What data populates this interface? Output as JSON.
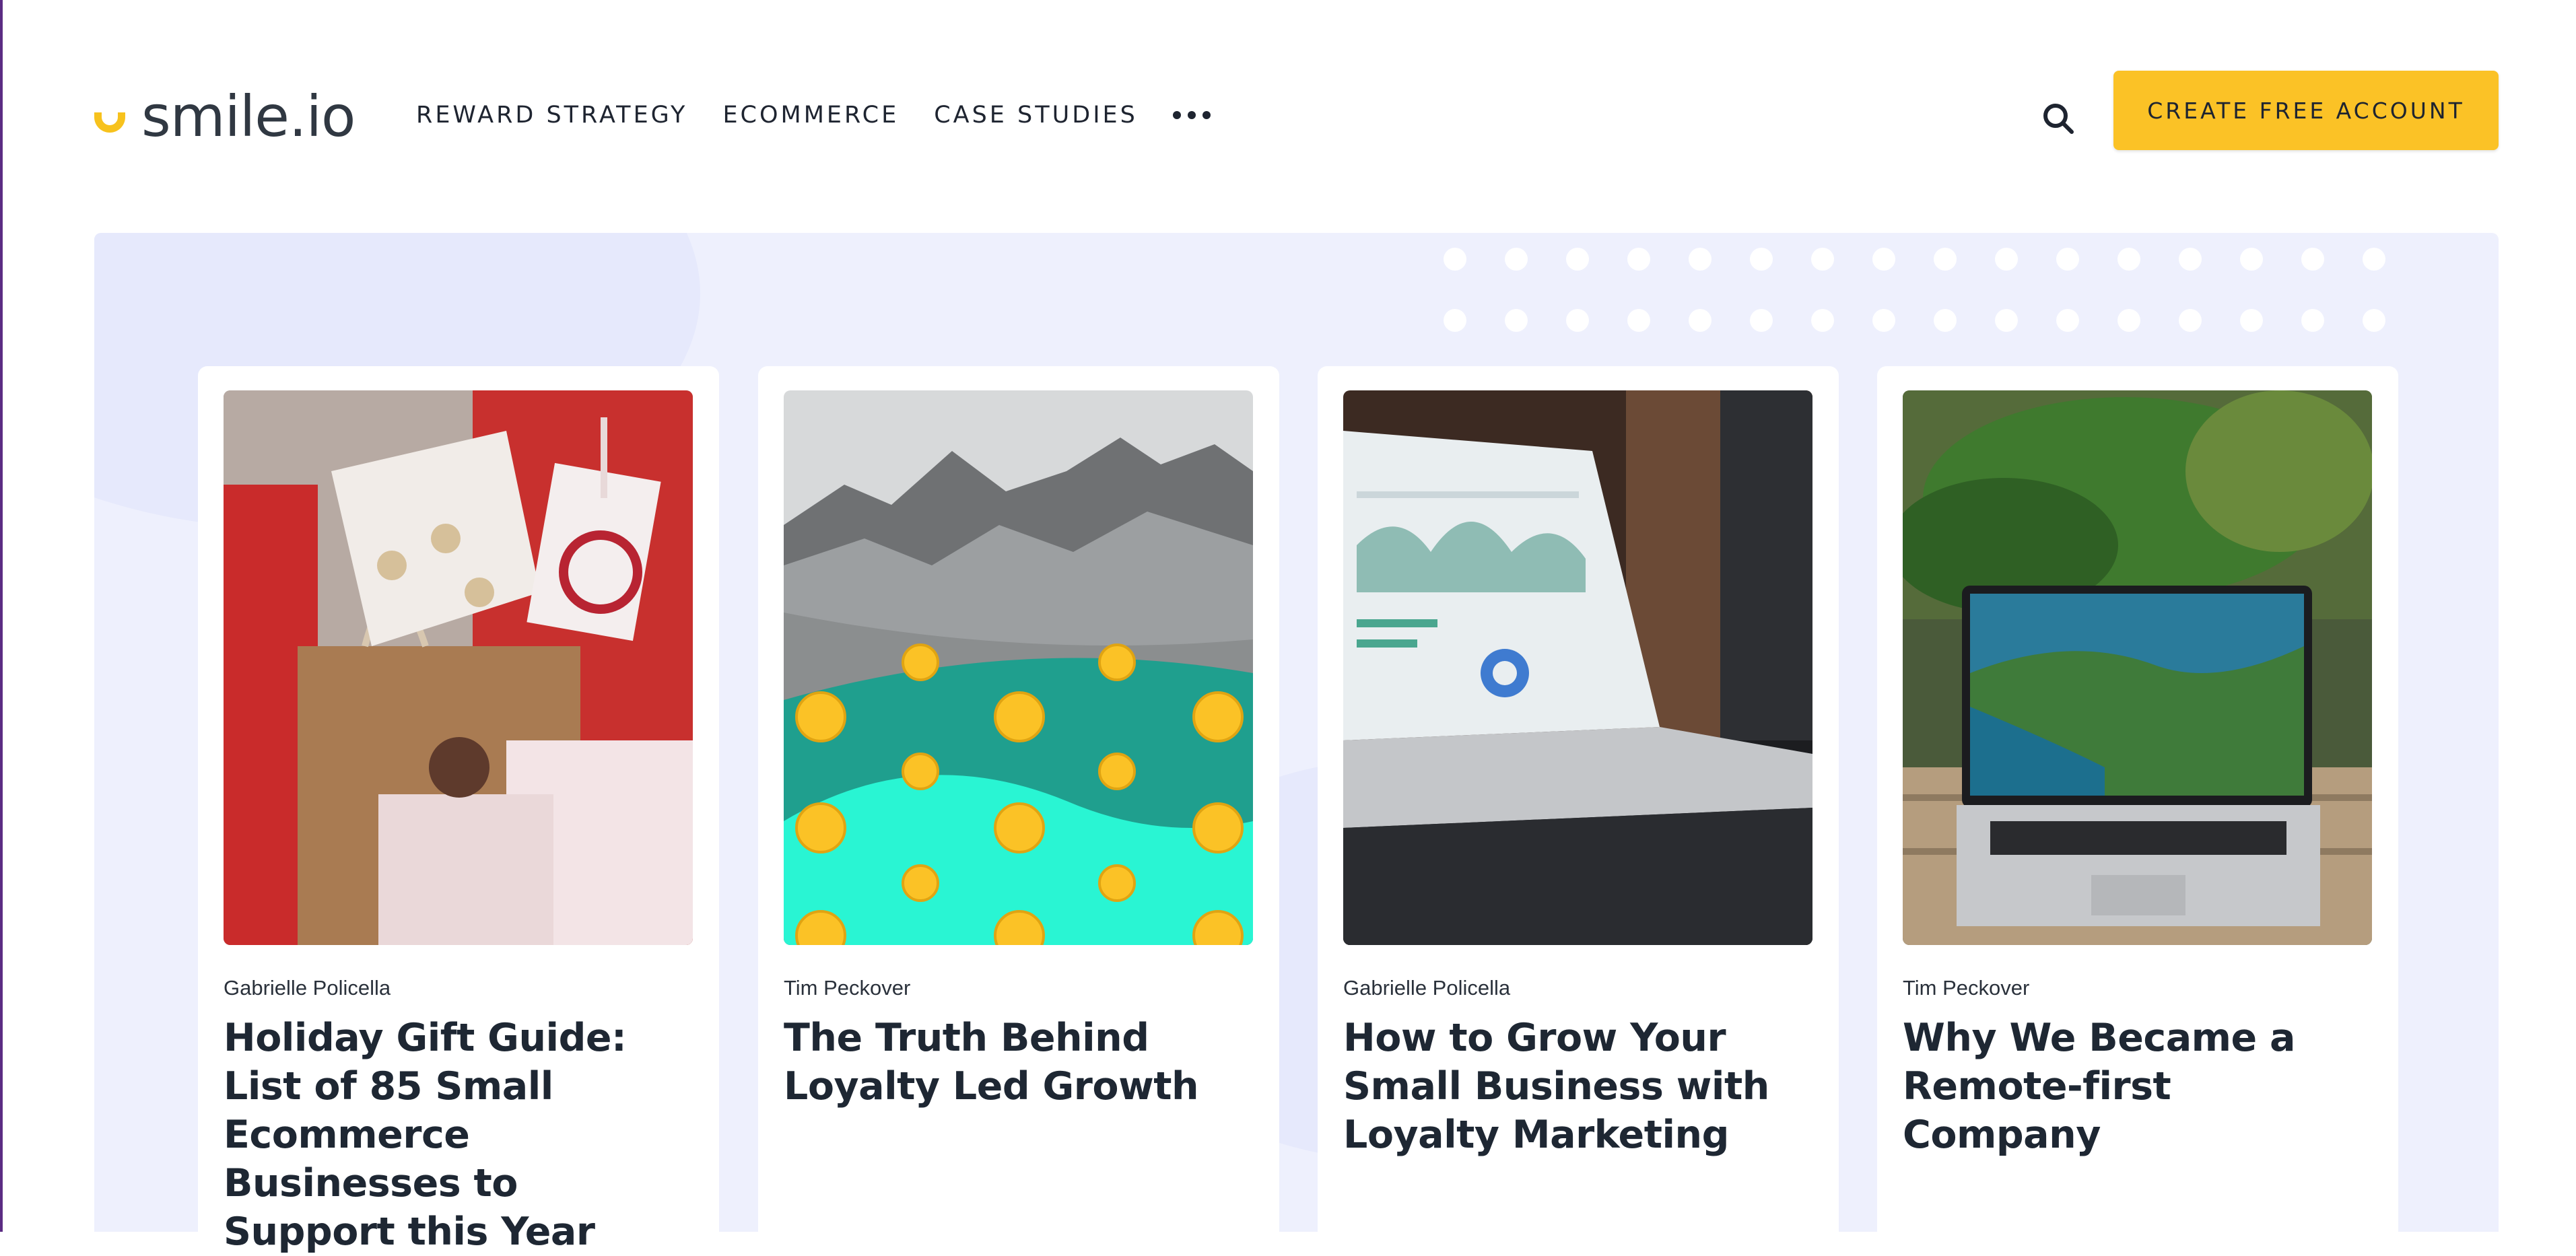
{
  "brand": {
    "name": "smile.io",
    "accent": "#fbc226"
  },
  "nav": {
    "items": [
      "REWARD STRATEGY",
      "ECOMMERCE",
      "CASE STUDIES"
    ],
    "more_icon": "more-horizontal-icon"
  },
  "header": {
    "search_icon": "search-icon",
    "cta_label": "CREATE FREE ACCOUNT"
  },
  "posts": [
    {
      "author": "Gabrielle Policella",
      "title": "Holiday Gift Guide: List of 85 Small Ecommerce Businesses to Support this Year"
    },
    {
      "author": "Tim Peckover",
      "title": "The Truth Behind Loyalty Led Growth"
    },
    {
      "author": "Gabrielle Policella",
      "title": "How to Grow Your Small Business with Loyalty Marketing"
    },
    {
      "author": "Tim Peckover",
      "title": "Why We Became a Remote-first Company"
    }
  ],
  "colors": {
    "panel_bg": "#eef0fd",
    "text": "#1e2733",
    "cta": "#fbc226"
  }
}
